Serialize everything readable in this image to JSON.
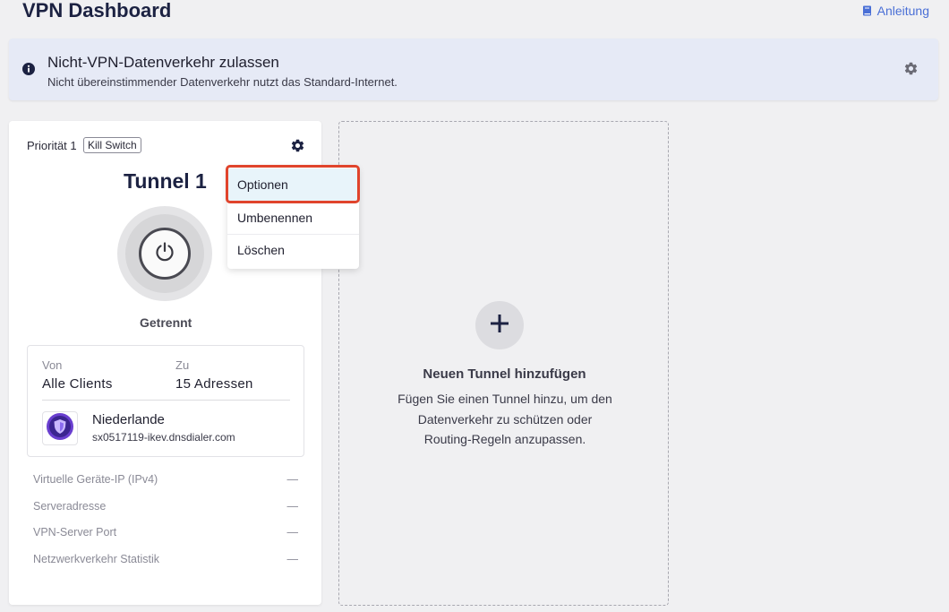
{
  "header": {
    "title": "VPN Dashboard",
    "guide_label": "Anleitung"
  },
  "banner": {
    "title": "Nicht-VPN-Datenverkehr zulassen",
    "subtitle": "Nicht übereinstimmender Datenverkehr nutzt das Standard-Internet."
  },
  "tunnel": {
    "priority": "Priorität 1",
    "kill_switch": "Kill Switch",
    "name": "Tunnel 1",
    "status": "Getrennt",
    "route": {
      "from_label": "Von",
      "from_value": "Alle Clients",
      "to_label": "Zu",
      "to_value": "15 Adressen"
    },
    "server": {
      "country": "Niederlande",
      "host": "sx0517119-ikev.dnsdialer.com"
    },
    "details": [
      {
        "label": "Virtuelle Geräte-IP (IPv4)",
        "value": "—"
      },
      {
        "label": "Serveradresse",
        "value": "—"
      },
      {
        "label": "VPN-Server Port",
        "value": "—"
      },
      {
        "label": "Netzwerkverkehr Statistik",
        "value": "—"
      }
    ]
  },
  "menu": {
    "items": [
      "Optionen",
      "Umbenennen",
      "Löschen"
    ]
  },
  "add_tunnel": {
    "title": "Neuen Tunnel hinzufügen",
    "desc_line1": "Fügen Sie einen Tunnel hinzu, um den",
    "desc_line2": "Datenverkehr zu schützen oder",
    "desc_line3": "Routing-Regeln anzupassen."
  },
  "colors": {
    "accent": "#4a6fd6",
    "highlight_frame": "#e0442c",
    "shield": "#6a3fd0"
  }
}
